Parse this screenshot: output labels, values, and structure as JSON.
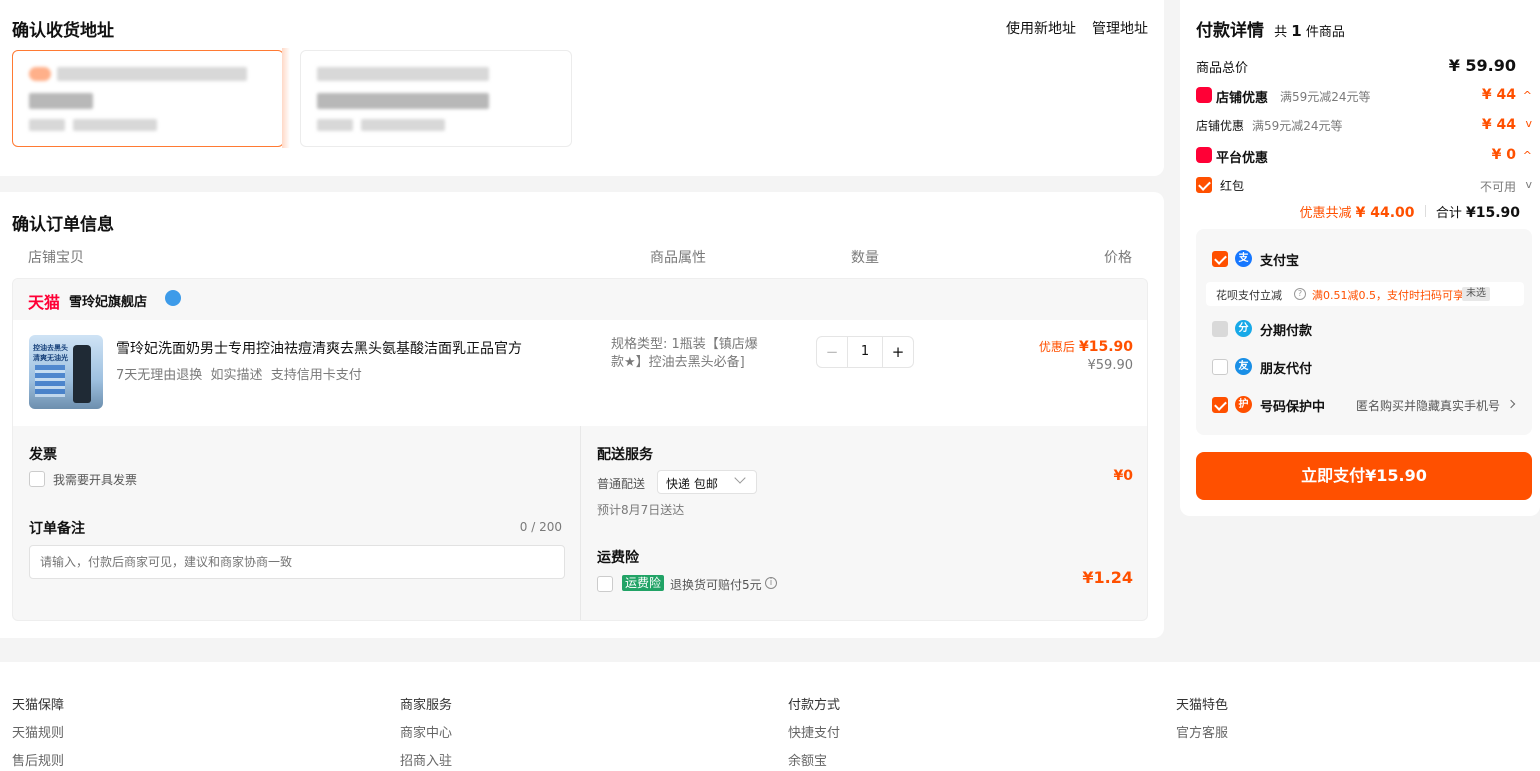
{
  "address": {
    "title": "确认收货地址",
    "new_link": "使用新地址",
    "manage_link": "管理地址"
  },
  "order": {
    "title": "确认订单信息",
    "headers": {
      "shop": "店铺宝贝",
      "attr": "商品属性",
      "qty": "数量",
      "price": "价格"
    },
    "store": {
      "brand": "天猫",
      "name": "雪玲妃旗舰店"
    },
    "item": {
      "name": "雪玲妃洗面奶男士专用控油祛痘清爽去黑头氨基酸洁面乳正品官方",
      "tags": "7天无理由退换  如实描述  支持信用卡支付",
      "thumb_line1": "控油去黑头",
      "thumb_line2": "清爽无油光",
      "spec": "规格类型: 1瓶装【镇店爆款★】控油去黑头必备]",
      "qty": "1",
      "minus": "−",
      "plus": "+",
      "price_label": "优惠后",
      "price_now": "¥15.90",
      "price_orig": "¥59.90"
    },
    "invoice": {
      "title": "发票",
      "option": "我需要开具发票"
    },
    "remark": {
      "title": "订单备注",
      "count": "0 / 200",
      "placeholder": "请输入，付款后商家可见，建议和商家协商一致"
    },
    "delivery": {
      "title": "配送服务",
      "label": "普通配送",
      "method": "快递 包邮",
      "eta": "预计8月7日送达",
      "fee": "¥0"
    },
    "insurance": {
      "title": "运费险",
      "badge": "运费险",
      "desc": "退换货可赔付5元",
      "fee": "¥1.24"
    }
  },
  "payment": {
    "title": "付款详情",
    "count_prefix": "共",
    "count": "1",
    "count_suffix": "件商品",
    "total_label": "商品总价",
    "total": "¥ 59.90",
    "shop_discount_title": "店铺优惠",
    "shop_discount_desc": "满59元减24元等",
    "shop_discount_amount": "¥ 44",
    "shop_discount_sub_title": "店铺优惠",
    "shop_discount_sub_desc": "满59元减24元等",
    "shop_discount_sub_amount": "¥ 44",
    "platform_title": "平台优惠",
    "platform_amount": "¥ 0",
    "redpack_label": "红包",
    "redpack_status": "不可用",
    "saved_label": "优惠共减",
    "saved": "¥ 44.00",
    "sum_label": "合计",
    "sum": "¥15.90",
    "methods": {
      "alipay": "支付宝",
      "huabei_label": "花呗支付立减",
      "huabei_offer": "满0.51减0.5，支付时扫码可享",
      "huabei_tag": "未选",
      "installment": "分期付款",
      "friend": "朋友代付",
      "privacy": "号码保护中",
      "privacy_desc": "匿名购买并隐藏真实手机号"
    },
    "pay_button": "立即支付¥15.90"
  },
  "footer": {
    "cols": [
      {
        "title": "天猫保障",
        "links": [
          "天猫规则",
          "售后规则"
        ]
      },
      {
        "title": "商家服务",
        "links": [
          "商家中心",
          "招商入驻"
        ]
      },
      {
        "title": "付款方式",
        "links": [
          "快捷支付",
          "余额宝"
        ]
      },
      {
        "title": "天猫特色",
        "links": [
          "官方客服"
        ]
      }
    ]
  },
  "colors": {
    "accent": "#ff5000",
    "tmall_red": "#ff0036",
    "alipay_blue": "#1677ff",
    "insurance_green": "#21a366"
  }
}
